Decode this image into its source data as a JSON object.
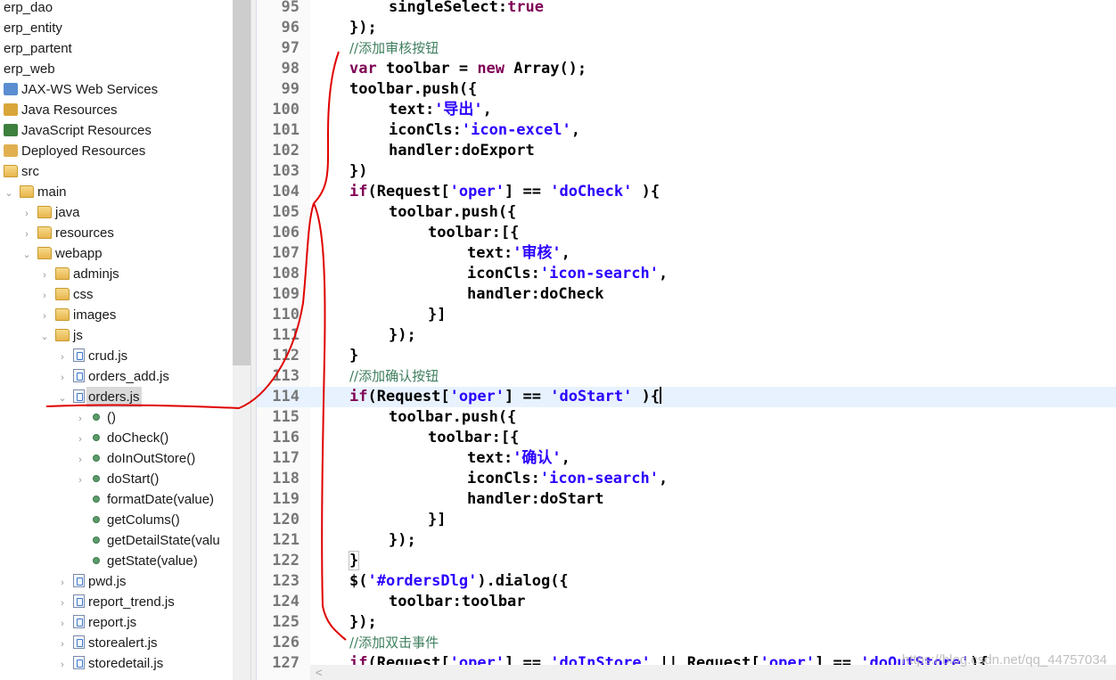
{
  "explorer": {
    "items": [
      {
        "label": "erp_dao",
        "indent": 0,
        "twisty": "",
        "icon": "none"
      },
      {
        "label": "erp_entity",
        "indent": 0,
        "twisty": "",
        "icon": "none"
      },
      {
        "label": "erp_partent",
        "indent": 0,
        "twisty": "",
        "icon": "none"
      },
      {
        "label": "erp_web",
        "indent": 0,
        "twisty": "",
        "icon": "none"
      },
      {
        "label": "JAX-WS Web Services",
        "indent": 0,
        "twisty": "",
        "icon": "web-services-icon"
      },
      {
        "label": "Java Resources",
        "indent": 0,
        "twisty": "",
        "icon": "java-resources-icon"
      },
      {
        "label": "JavaScript Resources",
        "indent": 0,
        "twisty": "",
        "icon": "javascript-resources-icon"
      },
      {
        "label": "Deployed Resources",
        "indent": 0,
        "twisty": "",
        "icon": "deployed-resources-icon"
      },
      {
        "label": "src",
        "indent": 0,
        "twisty": "",
        "icon": "folder-icon"
      },
      {
        "label": "main",
        "indent": 1,
        "twisty": "expanded",
        "icon": "folder-icon"
      },
      {
        "label": "java",
        "indent": 2,
        "twisty": "collapsed",
        "icon": "folder-icon"
      },
      {
        "label": "resources",
        "indent": 2,
        "twisty": "collapsed",
        "icon": "folder-icon"
      },
      {
        "label": "webapp",
        "indent": 2,
        "twisty": "expanded",
        "icon": "folder-icon"
      },
      {
        "label": "adminjs",
        "indent": 3,
        "twisty": "collapsed",
        "icon": "folder-icon"
      },
      {
        "label": "css",
        "indent": 3,
        "twisty": "collapsed",
        "icon": "folder-icon"
      },
      {
        "label": "images",
        "indent": 3,
        "twisty": "collapsed",
        "icon": "folder-icon"
      },
      {
        "label": "js",
        "indent": 3,
        "twisty": "expanded",
        "icon": "folder-icon"
      },
      {
        "label": "crud.js",
        "indent": 4,
        "twisty": "collapsed",
        "icon": "js-file-icon"
      },
      {
        "label": "orders_add.js",
        "indent": 4,
        "twisty": "collapsed",
        "icon": "js-file-icon"
      },
      {
        "label": "orders.js",
        "indent": 4,
        "twisty": "expanded",
        "icon": "js-file-icon",
        "selected": true
      },
      {
        "label": "()",
        "indent": 5,
        "twisty": "collapsed",
        "icon": "function-icon"
      },
      {
        "label": "doCheck()",
        "indent": 5,
        "twisty": "collapsed",
        "icon": "function-icon"
      },
      {
        "label": "doInOutStore()",
        "indent": 5,
        "twisty": "collapsed",
        "icon": "function-icon"
      },
      {
        "label": "doStart()",
        "indent": 5,
        "twisty": "collapsed",
        "icon": "function-icon"
      },
      {
        "label": "formatDate(value)",
        "indent": 5,
        "twisty": "none",
        "icon": "function-icon"
      },
      {
        "label": "getColums()",
        "indent": 5,
        "twisty": "none",
        "icon": "function-icon"
      },
      {
        "label": "getDetailState(valu",
        "indent": 5,
        "twisty": "none",
        "icon": "function-icon"
      },
      {
        "label": "getState(value)",
        "indent": 5,
        "twisty": "none",
        "icon": "function-icon"
      },
      {
        "label": "pwd.js",
        "indent": 4,
        "twisty": "collapsed",
        "icon": "js-file-icon"
      },
      {
        "label": "report_trend.js",
        "indent": 4,
        "twisty": "collapsed",
        "icon": "js-file-icon"
      },
      {
        "label": "report.js",
        "indent": 4,
        "twisty": "collapsed",
        "icon": "js-file-icon"
      },
      {
        "label": "storealert.js",
        "indent": 4,
        "twisty": "collapsed",
        "icon": "js-file-icon"
      },
      {
        "label": "storedetail.js",
        "indent": 4,
        "twisty": "collapsed",
        "icon": "js-file-icon"
      }
    ]
  },
  "editor": {
    "current_line": 114,
    "lines": [
      {
        "n": "95",
        "indent": 2,
        "tokens": [
          [
            "p",
            "singleSelect:"
          ],
          [
            "kw",
            "true"
          ]
        ]
      },
      {
        "n": "96",
        "indent": 1,
        "tokens": [
          [
            "p",
            "});"
          ]
        ]
      },
      {
        "n": "97",
        "indent": 1,
        "tokens": [
          [
            "cm",
            "//添加审核按钮"
          ]
        ]
      },
      {
        "n": "98",
        "indent": 1,
        "tokens": [
          [
            "kw",
            "var"
          ],
          [
            "p",
            " toolbar = "
          ],
          [
            "kw",
            "new"
          ],
          [
            "p",
            " Array();"
          ]
        ]
      },
      {
        "n": "99",
        "indent": 1,
        "tokens": [
          [
            "p",
            "toolbar.push({"
          ]
        ]
      },
      {
        "n": "100",
        "indent": 2,
        "tokens": [
          [
            "p",
            "text:"
          ],
          [
            "str",
            "'导出'"
          ],
          [
            "p",
            ","
          ]
        ]
      },
      {
        "n": "101",
        "indent": 2,
        "tokens": [
          [
            "p",
            "iconCls:"
          ],
          [
            "str",
            "'icon-excel'"
          ],
          [
            "p",
            ","
          ]
        ]
      },
      {
        "n": "102",
        "indent": 2,
        "tokens": [
          [
            "p",
            "handler:doExport"
          ]
        ]
      },
      {
        "n": "103",
        "indent": 1,
        "tokens": [
          [
            "p",
            "})"
          ]
        ]
      },
      {
        "n": "104",
        "indent": 1,
        "tokens": [
          [
            "kw",
            "if"
          ],
          [
            "p",
            "(Request["
          ],
          [
            "str",
            "'oper'"
          ],
          [
            "p",
            "] == "
          ],
          [
            "str",
            "'doCheck'"
          ],
          [
            "p",
            " ){"
          ]
        ]
      },
      {
        "n": "105",
        "indent": 2,
        "tokens": [
          [
            "p",
            "toolbar.push({"
          ]
        ]
      },
      {
        "n": "106",
        "indent": 3,
        "tokens": [
          [
            "p",
            "toolbar:[{"
          ]
        ]
      },
      {
        "n": "107",
        "indent": 4,
        "tokens": [
          [
            "p",
            "text:"
          ],
          [
            "str",
            "'审核'"
          ],
          [
            "p",
            ","
          ]
        ]
      },
      {
        "n": "108",
        "indent": 4,
        "tokens": [
          [
            "p",
            "iconCls:"
          ],
          [
            "str",
            "'icon-search'"
          ],
          [
            "p",
            ","
          ]
        ]
      },
      {
        "n": "109",
        "indent": 4,
        "tokens": [
          [
            "p",
            "handler:doCheck"
          ]
        ]
      },
      {
        "n": "110",
        "indent": 3,
        "tokens": [
          [
            "p",
            "}]"
          ]
        ]
      },
      {
        "n": "111",
        "indent": 2,
        "tokens": [
          [
            "p",
            "});"
          ]
        ]
      },
      {
        "n": "112",
        "indent": 1,
        "tokens": [
          [
            "p",
            "}"
          ]
        ]
      },
      {
        "n": "113",
        "indent": 1,
        "tokens": [
          [
            "cm",
            "//添加确认按钮"
          ]
        ]
      },
      {
        "n": "114",
        "indent": 1,
        "tokens": [
          [
            "kw",
            "if"
          ],
          [
            "p",
            "(Request["
          ],
          [
            "str",
            "'oper'"
          ],
          [
            "p",
            "] == "
          ],
          [
            "str",
            "'doStart'"
          ],
          [
            "p",
            " ){"
          ],
          [
            "caret",
            ""
          ]
        ]
      },
      {
        "n": "115",
        "indent": 2,
        "tokens": [
          [
            "p",
            "toolbar.push({"
          ]
        ]
      },
      {
        "n": "116",
        "indent": 3,
        "tokens": [
          [
            "p",
            "toolbar:[{"
          ]
        ]
      },
      {
        "n": "117",
        "indent": 4,
        "tokens": [
          [
            "p",
            "text:"
          ],
          [
            "str",
            "'确认'"
          ],
          [
            "p",
            ","
          ]
        ]
      },
      {
        "n": "118",
        "indent": 4,
        "tokens": [
          [
            "p",
            "iconCls:"
          ],
          [
            "str",
            "'icon-search'"
          ],
          [
            "p",
            ","
          ]
        ]
      },
      {
        "n": "119",
        "indent": 4,
        "tokens": [
          [
            "p",
            "handler:doStart"
          ]
        ]
      },
      {
        "n": "120",
        "indent": 3,
        "tokens": [
          [
            "p",
            "}]"
          ]
        ]
      },
      {
        "n": "121",
        "indent": 2,
        "tokens": [
          [
            "p",
            "});"
          ]
        ]
      },
      {
        "n": "122",
        "indent": 1,
        "tokens": [
          [
            "box",
            "}"
          ]
        ]
      },
      {
        "n": "123",
        "indent": 1,
        "tokens": [
          [
            "p",
            "$("
          ],
          [
            "str",
            "'#ordersDlg'"
          ],
          [
            "p",
            ").dialog({"
          ]
        ]
      },
      {
        "n": "124",
        "indent": 2,
        "tokens": [
          [
            "p",
            "toolbar:toolbar"
          ]
        ]
      },
      {
        "n": "125",
        "indent": 1,
        "tokens": [
          [
            "p",
            "});"
          ]
        ]
      },
      {
        "n": "126",
        "indent": 1,
        "tokens": [
          [
            "cm",
            "//添加双击事件"
          ]
        ]
      },
      {
        "n": "127",
        "indent": 1,
        "tokens": [
          [
            "kw",
            "if"
          ],
          [
            "p",
            "(Request["
          ],
          [
            "str",
            "'oper'"
          ],
          [
            "p",
            "] == "
          ],
          [
            "str",
            "'doInStore'"
          ],
          [
            "p",
            " || Request["
          ],
          [
            "str",
            "'oper'"
          ],
          [
            "p",
            "] == "
          ],
          [
            "str",
            "'doOutStore'"
          ],
          [
            "p",
            "){"
          ]
        ]
      }
    ]
  },
  "watermark": "https://blog.csdn.net/qq_44757034",
  "colors": {
    "keyword": "#7f0055",
    "string": "#2a00ff",
    "comment": "#3f7f5f",
    "annotation": "#e00000",
    "current_line_bg": "#e8f2fe"
  }
}
